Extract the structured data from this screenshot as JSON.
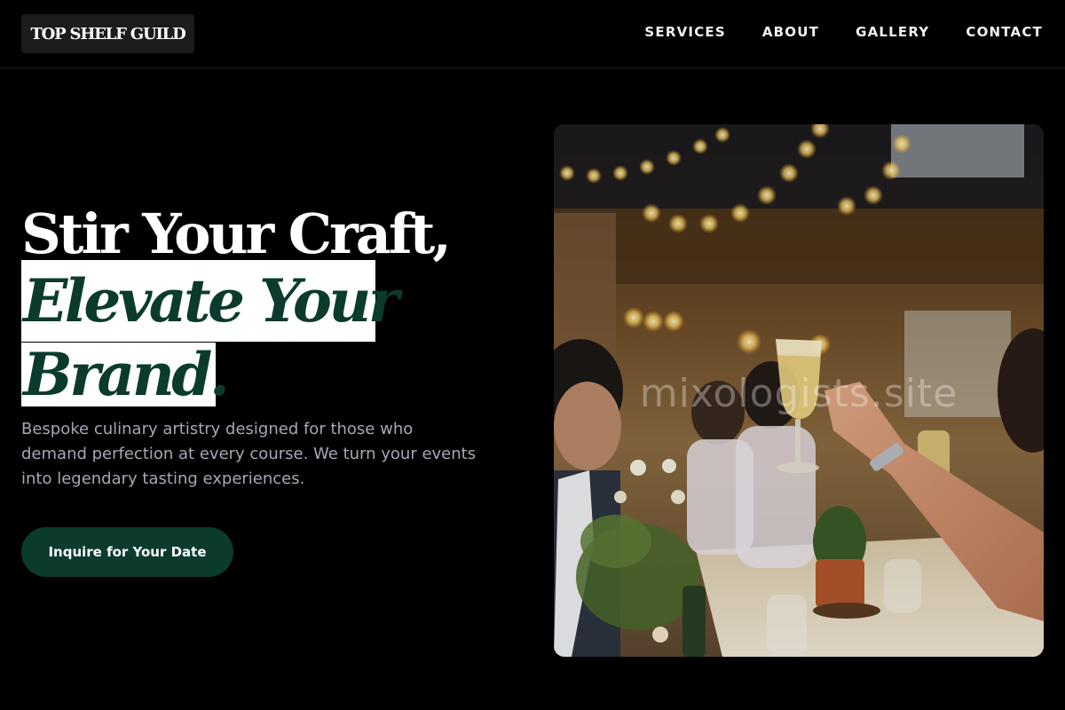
{
  "header": {
    "logo_text": "TOP SHELF GUILD",
    "nav": [
      {
        "label": "SERVICES"
      },
      {
        "label": "ABOUT"
      },
      {
        "label": "GALLERY"
      },
      {
        "label": "CONTACT"
      }
    ]
  },
  "hero": {
    "headline_line1": "Stir Your Craft,",
    "headline_highlight_1": "Elevate Your",
    "headline_highlight_2": "Brand.",
    "lead": "Bespoke culinary artistry designed for those who demand perfection at every course. We turn your events into legendary tasting experiences.",
    "cta_label": "Inquire for Your Date"
  },
  "image": {
    "watermark": "mixologists.site",
    "subject": "guests raising champagne glasses at a banquet table under string lights"
  },
  "colors": {
    "background": "#000000",
    "accent_green": "#0b3b2c",
    "highlight_bg": "#ffffff",
    "body_text": "#a7a7b6",
    "logo_bg": "#1c1c1c"
  }
}
